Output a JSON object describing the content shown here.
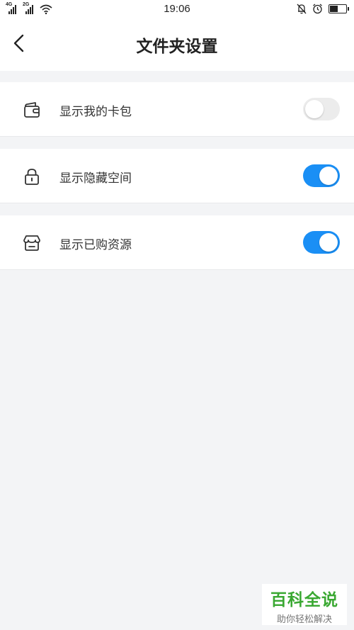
{
  "status_bar": {
    "network_1": "4G",
    "network_2": "2G",
    "time": "19:06",
    "battery_level": 0.45
  },
  "header": {
    "title": "文件夹设置",
    "back_icon": "chevron-left-icon"
  },
  "settings": [
    {
      "label": "显示我的卡包",
      "icon": "wallet-icon",
      "enabled": false
    },
    {
      "label": "显示隐藏空间",
      "icon": "lock-icon",
      "enabled": true
    },
    {
      "label": "显示已购资源",
      "icon": "store-icon",
      "enabled": true
    }
  ],
  "colors": {
    "toggle_on": "#1a8ff5",
    "toggle_off": "#ececec",
    "background": "#f3f4f6"
  },
  "watermark": {
    "main": "百科全说",
    "sub": "助你轻松解决"
  }
}
